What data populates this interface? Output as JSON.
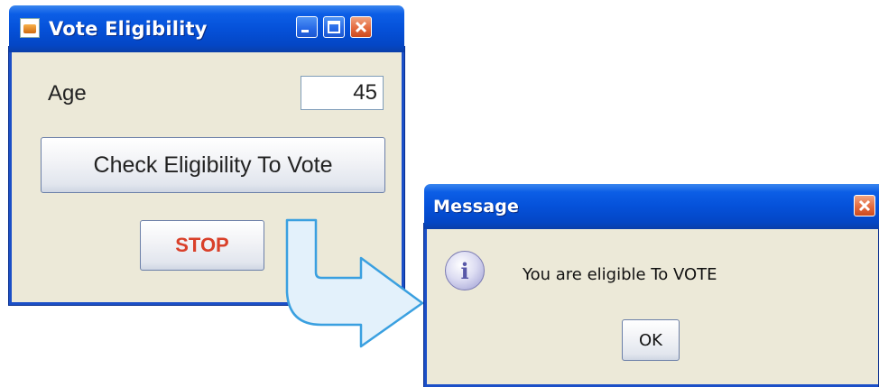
{
  "vote_window": {
    "title": "Vote Eligibility",
    "age_label": "Age",
    "age_value": "45",
    "check_button_label": "Check Eligibility To Vote",
    "stop_button_label": "STOP"
  },
  "message_window": {
    "title": "Message",
    "message": "You are eligible To VOTE",
    "ok_button_label": "OK",
    "icon": "info-icon",
    "icon_glyph": "i"
  },
  "colors": {
    "titlebar": "#0551d9",
    "window_bg": "#ece9d8",
    "stop_text": "#d9402a",
    "arrow_fill": "#e3f1fb",
    "arrow_stroke": "#3aa0e0"
  }
}
